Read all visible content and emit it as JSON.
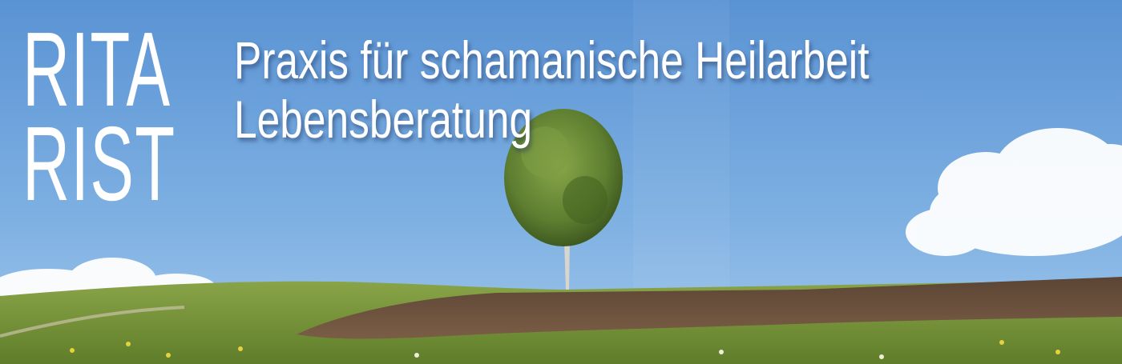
{
  "header": {
    "name_line_1": "RITA",
    "name_line_2": "RIST",
    "tagline_line_1": "Praxis für schamanische Heilarbeit",
    "tagline_line_2": "Lebensberatung"
  },
  "image": {
    "subject": "landscape-photo",
    "colors": {
      "sky": "#77aae0",
      "meadow": "#7f9a3a",
      "field": "#6b4e3a",
      "tree": "#5a7a2e",
      "text": "#ffffff"
    }
  }
}
